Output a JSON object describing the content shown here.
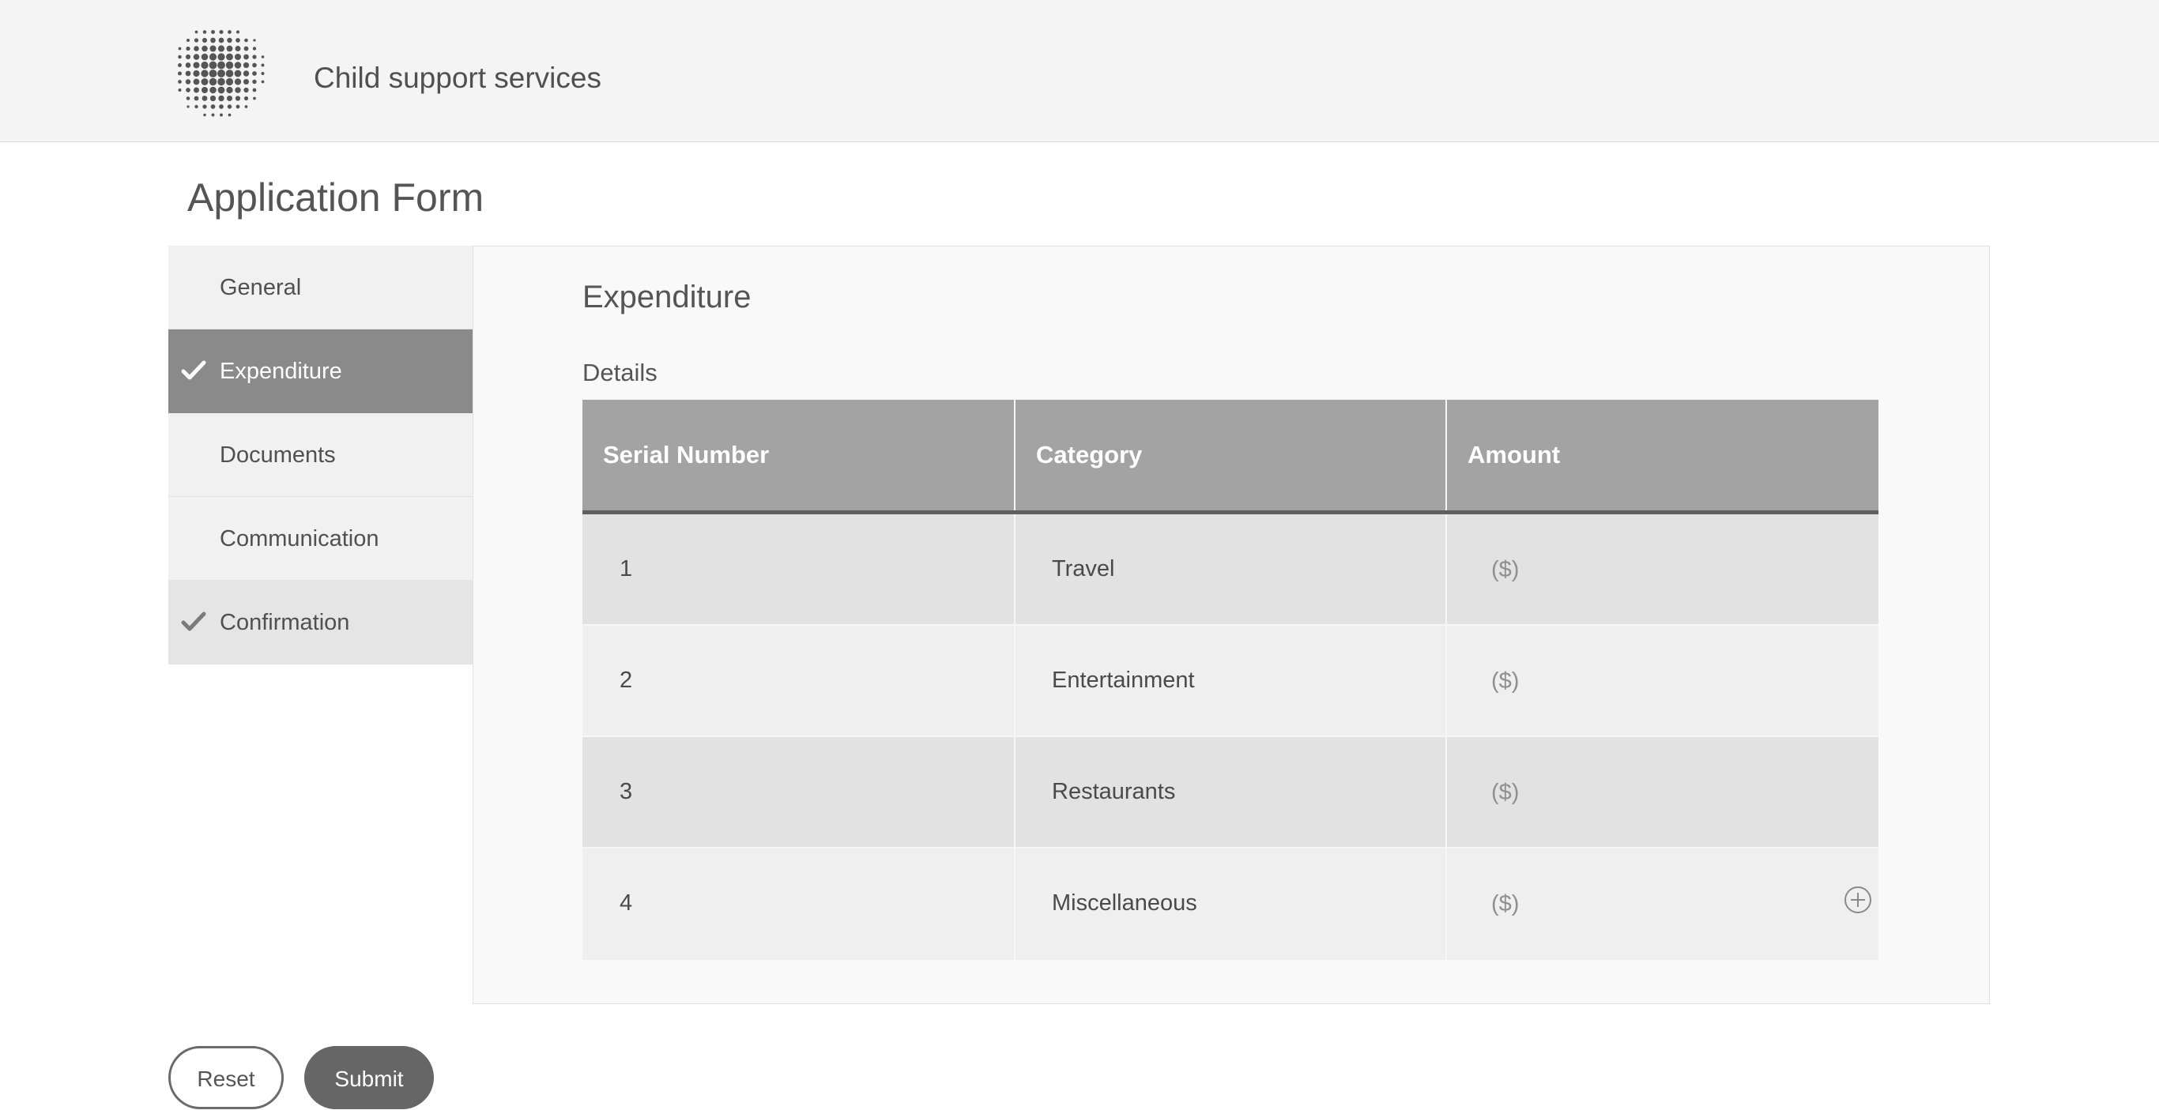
{
  "header": {
    "logo_icon": "dotted-sphere-logo",
    "app_title": "Child support services"
  },
  "page": {
    "title": "Application Form"
  },
  "sidebar": {
    "items": [
      {
        "label": "General",
        "state": "default"
      },
      {
        "label": "Expenditure",
        "state": "active",
        "icon": "checkmark-icon"
      },
      {
        "label": "Documents",
        "state": "default"
      },
      {
        "label": "Communication",
        "state": "default"
      },
      {
        "label": "Confirmation",
        "state": "completed",
        "icon": "checkmark-icon"
      }
    ]
  },
  "section": {
    "title": "Expenditure",
    "subtitle": "Details"
  },
  "table": {
    "headers": [
      "Serial Number",
      "Category",
      "Amount"
    ],
    "amount_placeholder": "($)",
    "add_row_icon": "plus-circle-icon",
    "rows": [
      {
        "serial": "1",
        "category": "Travel",
        "amount": ""
      },
      {
        "serial": "2",
        "category": "Entertainment",
        "amount": ""
      },
      {
        "serial": "3",
        "category": "Restaurants",
        "amount": ""
      },
      {
        "serial": "4",
        "category": "Miscellaneous",
        "amount": ""
      }
    ]
  },
  "actions": {
    "reset_label": "Reset",
    "submit_label": "Submit"
  },
  "colors": {
    "header_bg": "#f4f4f4",
    "active_nav_bg": "#8a8a8a",
    "table_header_bg": "#a3a3a3",
    "submit_bg": "#666666"
  }
}
